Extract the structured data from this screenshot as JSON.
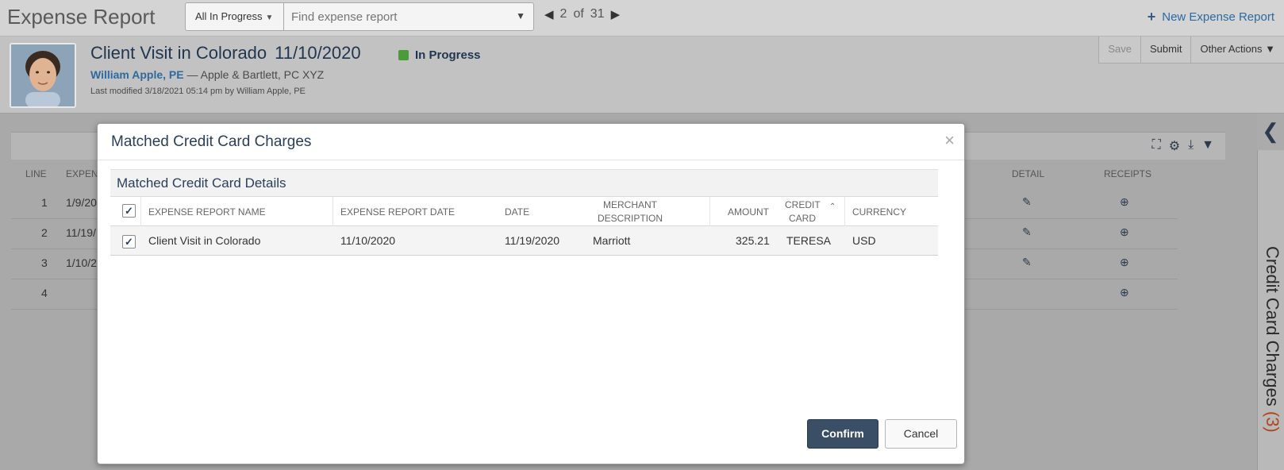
{
  "topbar": {
    "app_title": "Expense Report",
    "filter_label": "All In Progress",
    "search_placeholder": "Find expense report",
    "pager": {
      "current": "2",
      "of_label": "of",
      "total": "31"
    },
    "new_report_label": "New Expense Report"
  },
  "header": {
    "report_title": "Client Visit in Colorado",
    "report_date": "11/10/2020",
    "status": "In Progress",
    "status_color": "#4a9b3a",
    "owner": "William Apple, PE",
    "company": "— Apple & Bartlett, PC XYZ",
    "last_modified": "Last modified 3/18/2021 05:14 pm by William Apple, PE",
    "actions": {
      "save": "Save",
      "submit": "Submit",
      "other": "Other Actions"
    }
  },
  "background_table": {
    "headers": {
      "line": "LINE",
      "expense": "EXPEN",
      "detail": "DETAIL",
      "receipts": "RECEIPTS"
    },
    "rows": [
      {
        "line": "1",
        "date": "1/9/20"
      },
      {
        "line": "2",
        "date": "11/19/"
      },
      {
        "line": "3",
        "date": "1/10/2"
      },
      {
        "line": "4",
        "date": ""
      }
    ]
  },
  "side_panel": {
    "label": "Credit Card Charges",
    "count": "(3)"
  },
  "modal": {
    "title": "Matched Credit Card Charges",
    "close_glyph": "×",
    "section_title": "Matched Credit Card Details",
    "columns": {
      "report_name": "EXPENSE REPORT NAME",
      "report_date": "EXPENSE REPORT DATE",
      "date": "DATE",
      "merchant_1": "MERCHANT",
      "merchant_2": "DESCRIPTION",
      "amount": "AMOUNT",
      "card_1": "CREDIT",
      "card_2": "CARD",
      "currency": "CURRENCY"
    },
    "row": {
      "report_name": "Client Visit in Colorado",
      "report_date": "11/10/2020",
      "date": "11/19/2020",
      "merchant": "Marriott",
      "amount": "325.21",
      "card": "TERESA",
      "currency": "USD"
    },
    "confirm_label": "Confirm",
    "cancel_label": "Cancel"
  }
}
